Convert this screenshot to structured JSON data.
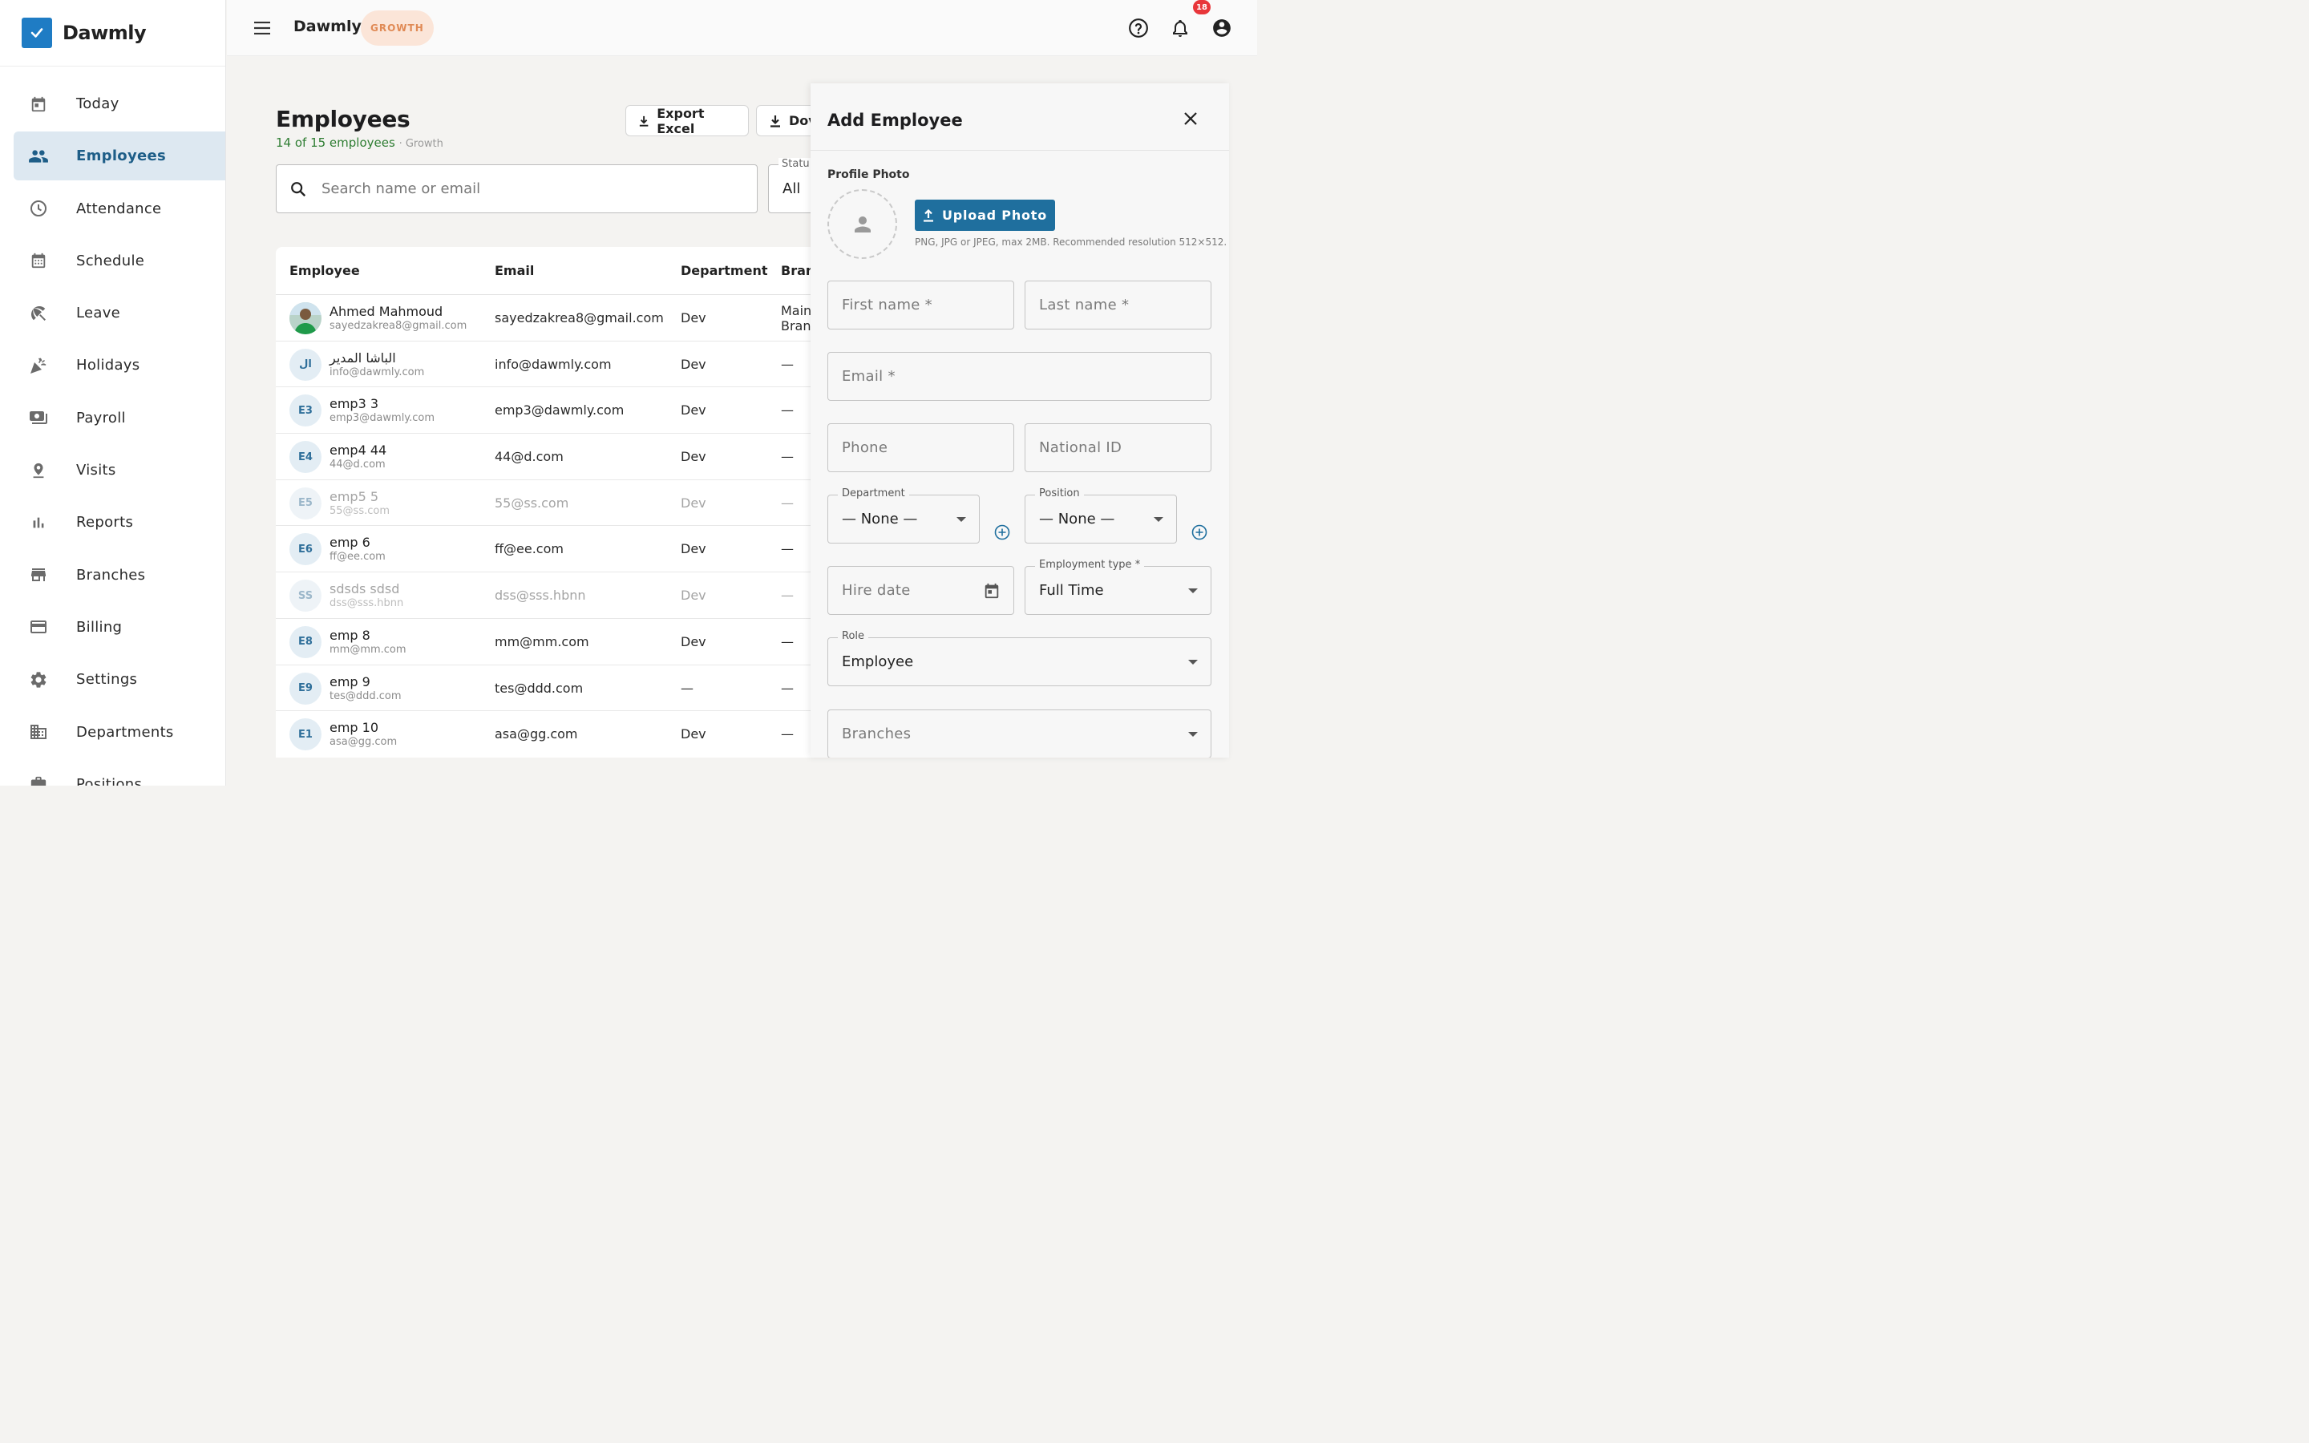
{
  "app": {
    "name": "Dawmly",
    "plan": "GROWTH",
    "notifications_count": "18"
  },
  "sidebar": {
    "items": [
      {
        "label": "Today",
        "icon": "calendar-today-icon"
      },
      {
        "label": "Employees",
        "icon": "people-icon",
        "active": true
      },
      {
        "label": "Attendance",
        "icon": "clock-icon"
      },
      {
        "label": "Schedule",
        "icon": "calendar-grid-icon"
      },
      {
        "label": "Leave",
        "icon": "beach-umbrella-icon"
      },
      {
        "label": "Holidays",
        "icon": "celebration-icon"
      },
      {
        "label": "Payroll",
        "icon": "payments-icon"
      },
      {
        "label": "Visits",
        "icon": "location-pin-icon"
      },
      {
        "label": "Reports",
        "icon": "bar-chart-icon"
      },
      {
        "label": "Branches",
        "icon": "store-icon"
      },
      {
        "label": "Billing",
        "icon": "credit-card-icon"
      },
      {
        "label": "Settings",
        "icon": "gear-icon"
      },
      {
        "label": "Departments",
        "icon": "building-icon"
      },
      {
        "label": "Positions",
        "icon": "briefcase-icon"
      }
    ]
  },
  "main": {
    "title": "Employees",
    "count_text": "14 of 15 employees",
    "plan_text": "· Growth",
    "export_label": "Export Excel",
    "download_label": "Dov",
    "search_placeholder": "Search name or email",
    "status_label": "Statu",
    "status_value": "All",
    "columns": {
      "employee": "Employee",
      "email": "Email",
      "department": "Department",
      "branch": "Bran"
    },
    "rows": [
      {
        "initials": "",
        "photo": true,
        "name": "Ahmed Mahmoud",
        "sub": "sayedzakrea8@gmail.com",
        "email": "sayedzakrea8@gmail.com",
        "department": "Dev",
        "branch": "Main Bran",
        "muted": false
      },
      {
        "initials": "ال",
        "name": "الباشا المدير",
        "sub": "info@dawmly.com",
        "email": "info@dawmly.com",
        "department": "Dev",
        "branch": "—",
        "muted": false
      },
      {
        "initials": "E3",
        "name": "emp3 3",
        "sub": "emp3@dawmly.com",
        "email": "emp3@dawmly.com",
        "department": "Dev",
        "branch": "—",
        "muted": false
      },
      {
        "initials": "E4",
        "name": "emp4 44",
        "sub": "44@d.com",
        "email": "44@d.com",
        "department": "Dev",
        "branch": "—",
        "muted": false
      },
      {
        "initials": "E5",
        "name": "emp5 5",
        "sub": "55@ss.com",
        "email": "55@ss.com",
        "department": "Dev",
        "branch": "—",
        "muted": true
      },
      {
        "initials": "E6",
        "name": "emp 6",
        "sub": "ff@ee.com",
        "email": "ff@ee.com",
        "department": "Dev",
        "branch": "—",
        "muted": false
      },
      {
        "initials": "SS",
        "name": "sdsds sdsd",
        "sub": "dss@sss.hbnn",
        "email": "dss@sss.hbnn",
        "department": "Dev",
        "branch": "—",
        "muted": true
      },
      {
        "initials": "E8",
        "name": "emp 8",
        "sub": "mm@mm.com",
        "email": "mm@mm.com",
        "department": "Dev",
        "branch": "—",
        "muted": false
      },
      {
        "initials": "E9",
        "name": "emp 9",
        "sub": "tes@ddd.com",
        "email": "tes@ddd.com",
        "department": "—",
        "branch": "—",
        "muted": false
      },
      {
        "initials": "E1",
        "name": "emp 10",
        "sub": "asa@gg.com",
        "email": "asa@gg.com",
        "department": "Dev",
        "branch": "—",
        "muted": false
      }
    ]
  },
  "drawer": {
    "title": "Add Employee",
    "photo_label": "Profile Photo",
    "upload_label": "Upload Photo",
    "upload_hint": "PNG, JPG or JPEG, max 2MB. Recommended resolution 512×512.",
    "first_name": "First name *",
    "last_name": "Last name *",
    "email": "Email *",
    "phone": "Phone",
    "national_id": "National ID",
    "department_label": "Department",
    "department_value": "— None —",
    "position_label": "Position",
    "position_value": "— None —",
    "hire_date": "Hire date",
    "employment_type_label": "Employment type *",
    "employment_type_value": "Full Time",
    "role_label": "Role",
    "role_value": "Employee",
    "branches": "Branches"
  },
  "colors": {
    "accent": "#1f6f9e",
    "active_bg": "#dde8f1",
    "plan_chip_bg": "#fbe5d8",
    "plan_chip_text": "#e08a55",
    "badge": "#e8363a",
    "success": "#2e7d32"
  }
}
